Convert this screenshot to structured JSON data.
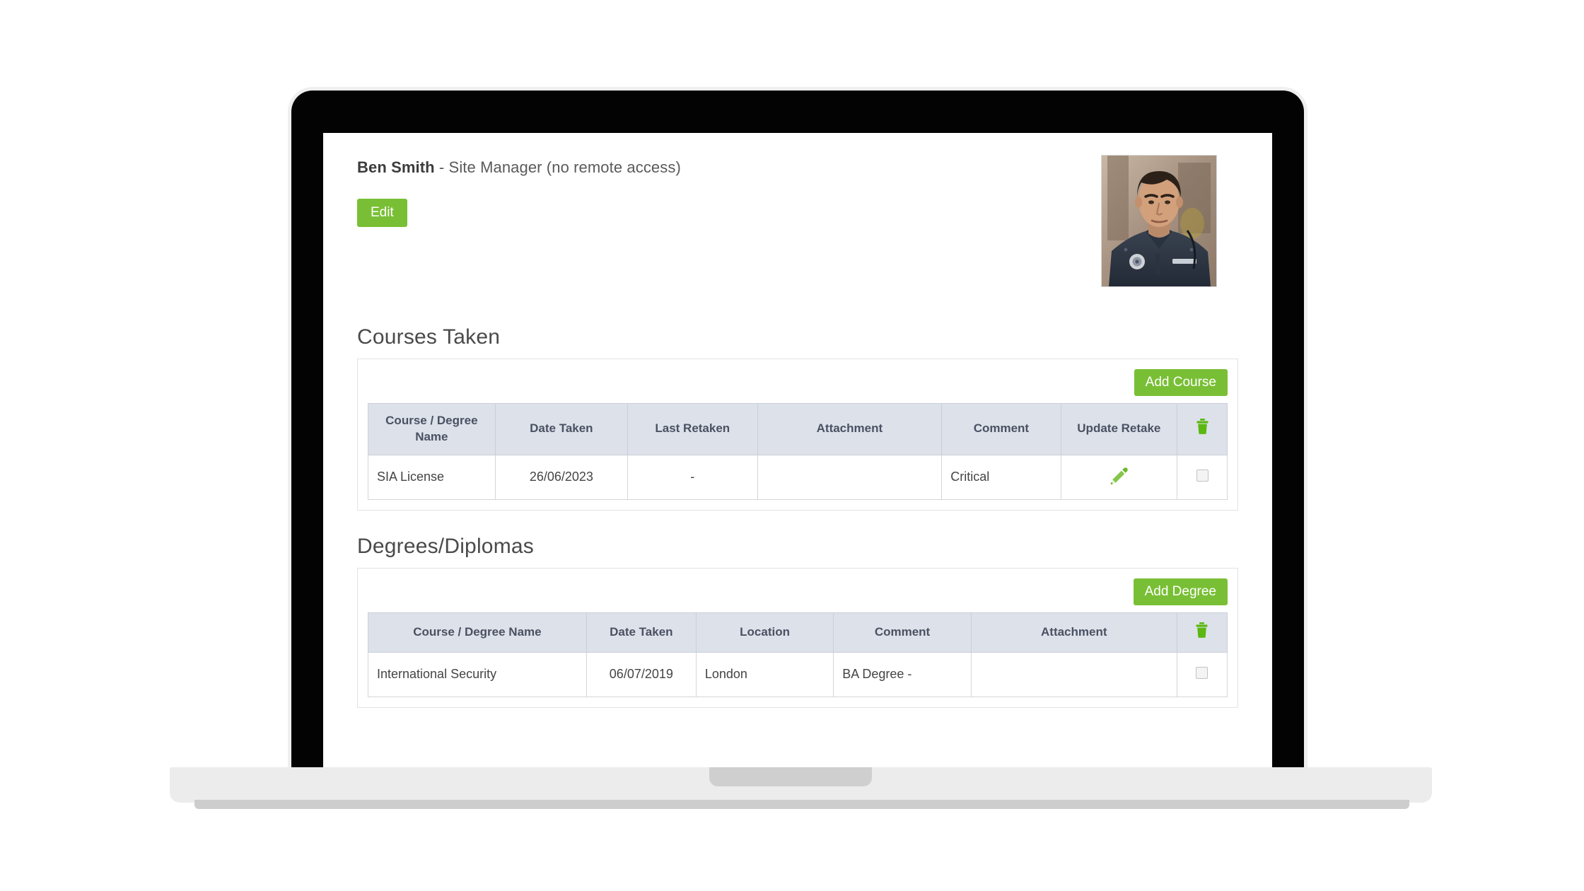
{
  "profile": {
    "name": "Ben Smith",
    "role_separator": " - ",
    "role": "Site Manager (no remote access)",
    "edit_label": "Edit",
    "photo_alt": "employee-photo-security-officer"
  },
  "courses_section": {
    "title": "Courses Taken",
    "add_label": "Add Course",
    "delete_icon": "trash-icon",
    "columns": [
      "Course / Degree Name",
      "Date Taken",
      "Last Retaken",
      "Attachment",
      "Comment",
      "Update Retake",
      "trash-icon"
    ],
    "rows": [
      {
        "name": "SIA License",
        "date_taken": "26/06/2023",
        "last_retaken": "-",
        "attachment": "",
        "comment": "Critical",
        "update_retake": "pencil-icon",
        "select": "checkbox"
      }
    ]
  },
  "degrees_section": {
    "title": "Degrees/Diplomas",
    "add_label": "Add Degree",
    "delete_icon": "trash-icon",
    "columns": [
      "Course / Degree Name",
      "Date Taken",
      "Location",
      "Comment",
      "Attachment",
      "trash-icon"
    ],
    "rows": [
      {
        "name": "International Security",
        "date_taken": "06/07/2019",
        "location": "London",
        "comment": "BA Degree -",
        "attachment": "",
        "select": "checkbox"
      }
    ]
  },
  "colors": {
    "accent_green": "#79bf35",
    "table_header_bg": "#dde1e9",
    "table_header_text": "#4a5163",
    "body_text": "#444444",
    "heading_text": "#4a4a4a",
    "laptop_bezel": "#030303",
    "laptop_base": "#ececec"
  }
}
